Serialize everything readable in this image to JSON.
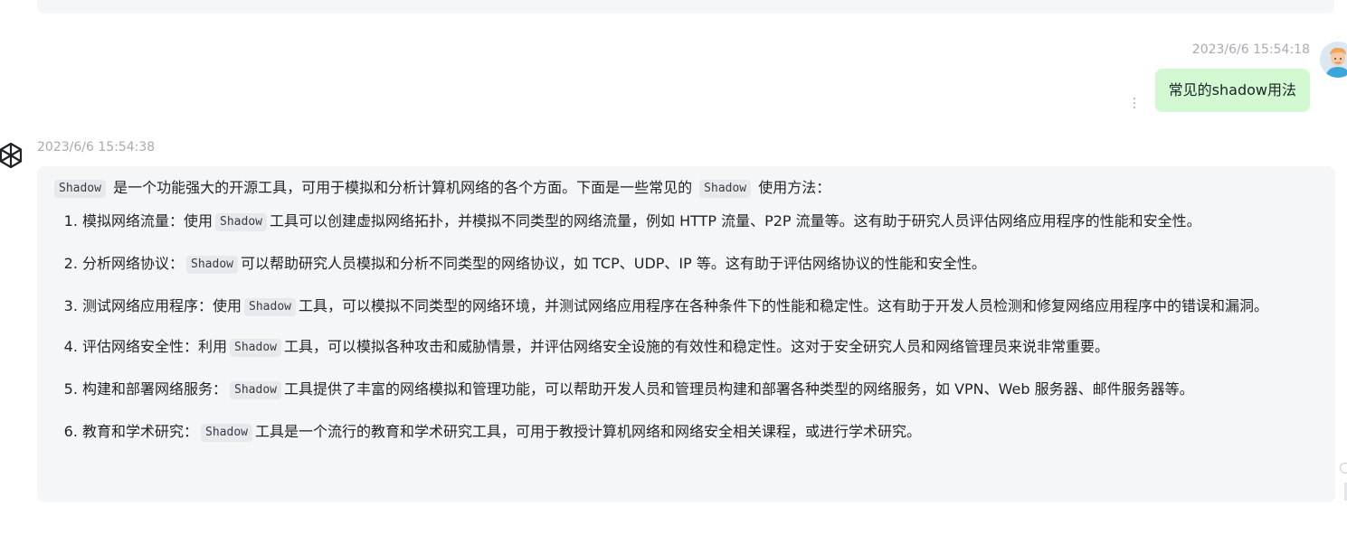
{
  "user_message": {
    "timestamp": "2023/6/6 15:54:18",
    "text": "常见的shadow用法"
  },
  "assistant_message": {
    "timestamp": "2023/6/6 15:54:38",
    "intro": {
      "code": "Shadow",
      "text1": "是一个功能强大的开源工具，可用于模拟和分析计算机网络的各个方面。下面是一些常见的",
      "code2": "Shadow",
      "text2": "使用方法："
    },
    "points": [
      {
        "before": "模拟网络流量：使用",
        "code": "Shadow",
        "after": "工具可以创建虚拟网络拓扑，并模拟不同类型的网络流量，例如 HTTP 流量、P2P 流量等。这有助于研究人员评估网络应用程序的性能和安全性。"
      },
      {
        "before": "分析网络协议：",
        "code": "Shadow",
        "after": "可以帮助研究人员模拟和分析不同类型的网络协议，如 TCP、UDP、IP 等。这有助于评估网络协议的性能和安全性。"
      },
      {
        "before": "测试网络应用程序：使用",
        "code": "Shadow",
        "after": "工具，可以模拟不同类型的网络环境，并测试网络应用程序在各种条件下的性能和稳定性。这有助于开发人员检测和修复网络应用程序中的错误和漏洞。"
      },
      {
        "before": "评估网络安全性：利用",
        "code": "Shadow",
        "after": "工具，可以模拟各种攻击和威胁情景，并评估网络安全设施的有效性和稳定性。这对于安全研究人员和网络管理员来说非常重要。"
      },
      {
        "before": "构建和部署网络服务：",
        "code": "Shadow",
        "after": "工具提供了丰富的网络模拟和管理功能，可以帮助开发人员和管理员构建和部署各种类型的网络服务，如 VPN、Web 服务器、邮件服务器等。"
      },
      {
        "before": "教育和学术研究：",
        "code": "Shadow",
        "after": "工具是一个流行的教育和学术研究工具，可用于教授计算机网络和网络安全相关课程，或进行学术研究。"
      }
    ]
  },
  "icons": {
    "user_avatar": "user-avatar-icon",
    "assistant_logo": "openai-logo-icon",
    "more": "more-vertical-icon"
  },
  "colors": {
    "user_bubble": "#d2f9d1",
    "assistant_bubble": "#f4f6f8",
    "timestamp": "#a8abb2"
  }
}
